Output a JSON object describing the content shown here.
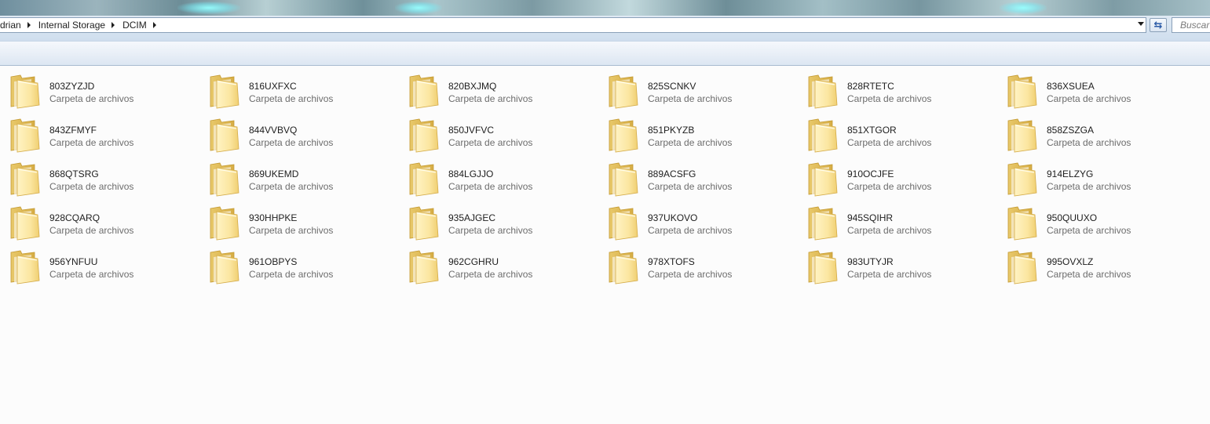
{
  "breadcrumb": {
    "segments": [
      "drian",
      "Internal Storage",
      "DCIM"
    ]
  },
  "search": {
    "placeholder": "Buscar"
  },
  "folders": [
    {
      "name": "803ZYZJD",
      "type": "Carpeta de archivos"
    },
    {
      "name": "816UXFXC",
      "type": "Carpeta de archivos"
    },
    {
      "name": "820BXJMQ",
      "type": "Carpeta de archivos"
    },
    {
      "name": "825SCNKV",
      "type": "Carpeta de archivos"
    },
    {
      "name": "828RTETC",
      "type": "Carpeta de archivos"
    },
    {
      "name": "836XSUEA",
      "type": "Carpeta de archivos"
    },
    {
      "name": "843ZFMYF",
      "type": "Carpeta de archivos"
    },
    {
      "name": "844VVBVQ",
      "type": "Carpeta de archivos"
    },
    {
      "name": "850JVFVC",
      "type": "Carpeta de archivos"
    },
    {
      "name": "851PKYZB",
      "type": "Carpeta de archivos"
    },
    {
      "name": "851XTGOR",
      "type": "Carpeta de archivos"
    },
    {
      "name": "858ZSZGA",
      "type": "Carpeta de archivos"
    },
    {
      "name": "868QTSRG",
      "type": "Carpeta de archivos"
    },
    {
      "name": "869UKEMD",
      "type": "Carpeta de archivos"
    },
    {
      "name": "884LGJJO",
      "type": "Carpeta de archivos"
    },
    {
      "name": "889ACSFG",
      "type": "Carpeta de archivos"
    },
    {
      "name": "910OCJFE",
      "type": "Carpeta de archivos"
    },
    {
      "name": "914ELZYG",
      "type": "Carpeta de archivos"
    },
    {
      "name": "928CQARQ",
      "type": "Carpeta de archivos"
    },
    {
      "name": "930HHPKE",
      "type": "Carpeta de archivos"
    },
    {
      "name": "935AJGEC",
      "type": "Carpeta de archivos"
    },
    {
      "name": "937UKOVO",
      "type": "Carpeta de archivos"
    },
    {
      "name": "945SQIHR",
      "type": "Carpeta de archivos"
    },
    {
      "name": "950QUUXO",
      "type": "Carpeta de archivos"
    },
    {
      "name": "956YNFUU",
      "type": "Carpeta de archivos"
    },
    {
      "name": "961OBPYS",
      "type": "Carpeta de archivos"
    },
    {
      "name": "962CGHRU",
      "type": "Carpeta de archivos"
    },
    {
      "name": "978XTOFS",
      "type": "Carpeta de archivos"
    },
    {
      "name": "983UTYJR",
      "type": "Carpeta de archivos"
    },
    {
      "name": "995OVXLZ",
      "type": "Carpeta de archivos"
    }
  ],
  "icons": {
    "folder": "folder-icon",
    "breadcrumb_separator": "chevron-right-icon",
    "address_dropdown": "chevron-down-icon",
    "refresh": "refresh-icon"
  },
  "colors": {
    "folder_light": "#fbe9a6",
    "folder_dark": "#e3bf5c",
    "accent": "#2a5aa6"
  }
}
